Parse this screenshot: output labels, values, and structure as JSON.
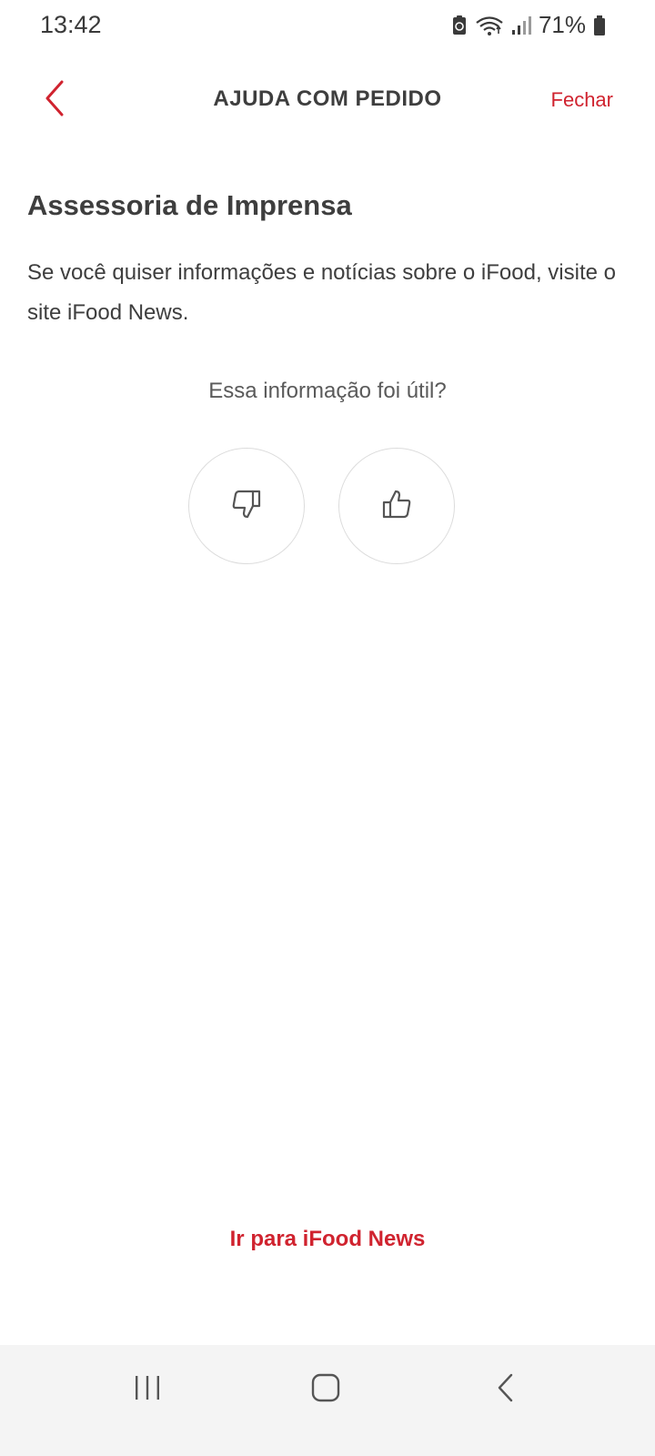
{
  "status_bar": {
    "time": "13:42",
    "battery_percent": "71%",
    "icons": [
      "battery-saver-icon",
      "wifi-icon",
      "signal-icon",
      "battery-icon"
    ]
  },
  "header": {
    "back_icon": "chevron-left-icon",
    "title": "AJUDA COM PEDIDO",
    "close_label": "Fechar"
  },
  "article": {
    "title": "Assessoria de Imprensa",
    "body": "Se você quiser informações e notícias sobre o iFood, visite o site iFood News."
  },
  "feedback": {
    "question": "Essa informação foi útil?",
    "no_icon": "thumbs-down-icon",
    "yes_icon": "thumbs-up-icon"
  },
  "cta": {
    "label": "Ir para iFood News"
  },
  "nav_bar": {
    "recents_icon": "recents-icon",
    "home_icon": "home-icon",
    "back_icon": "back-icon"
  },
  "colors": {
    "accent": "#d0232f",
    "text": "#3e3e3e",
    "nav_background": "#f4f4f4"
  }
}
